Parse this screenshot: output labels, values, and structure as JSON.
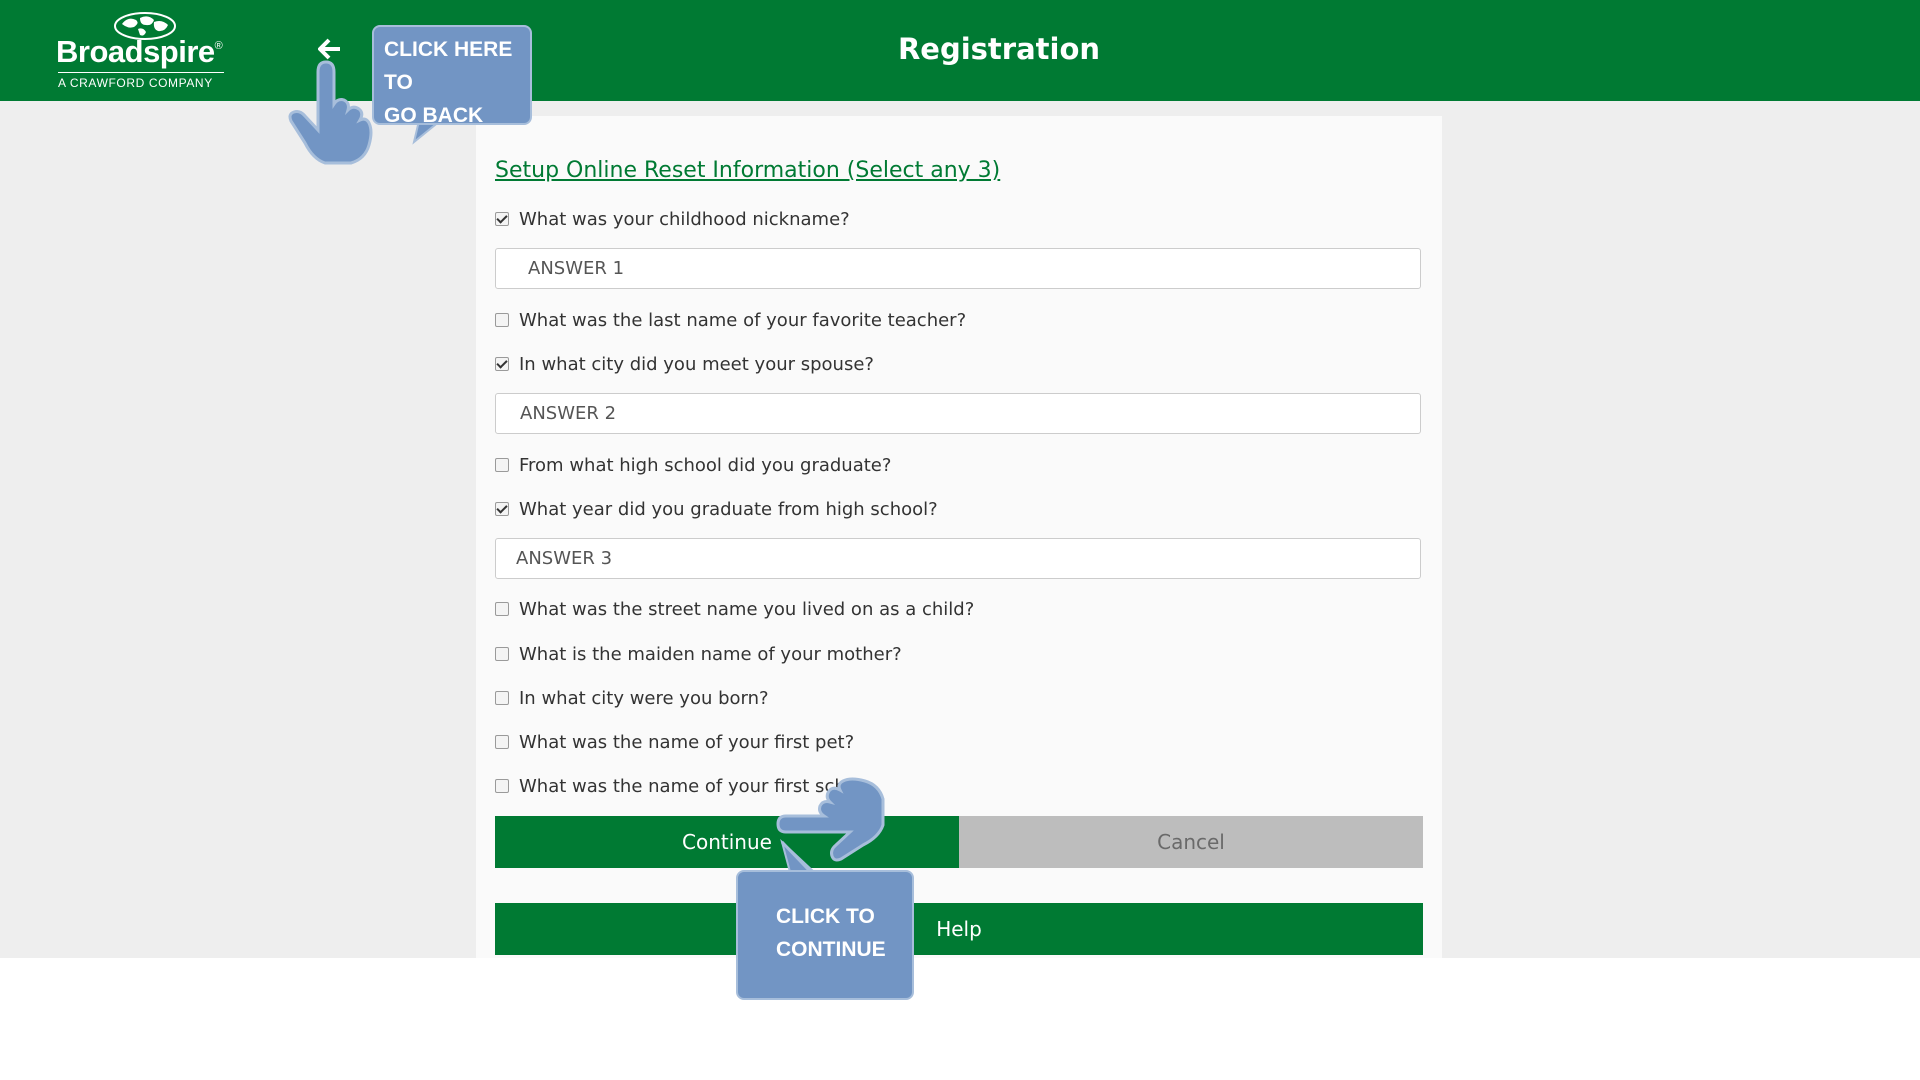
{
  "header": {
    "logo_name": "Broadspire",
    "logo_reg": "®",
    "logo_sub": "A CRAWFORD COMPANY",
    "back_icon": "arrow-left-icon",
    "title": "Registration",
    "color": "#007a33"
  },
  "form": {
    "section_title": "Setup Online Reset Information (Select any 3)",
    "questions": [
      {
        "label": "What was your childhood nickname?",
        "checked": true
      },
      {
        "label": "What was the last name of your favorite teacher?",
        "checked": false
      },
      {
        "label": "In what city did you meet your spouse?",
        "checked": true
      },
      {
        "label": "From what high school did you graduate?",
        "checked": false
      },
      {
        "label": "What year did you graduate from high school?",
        "checked": true
      },
      {
        "label": "What was the street name you lived on as a child?",
        "checked": false
      },
      {
        "label": "What is the maiden name of your mother?",
        "checked": false
      },
      {
        "label": "In what city were you born?",
        "checked": false
      },
      {
        "label": "What was the name of your first pet?",
        "checked": false
      },
      {
        "label": "What was the name of your first sch",
        "checked": false
      }
    ],
    "answers": [
      {
        "value": "ANSWER 1",
        "placeholder": ""
      },
      {
        "value": "ANSWER 2",
        "placeholder": ""
      },
      {
        "value": "ANSWER 3",
        "placeholder": ""
      }
    ],
    "buttons": {
      "continue": "Continue",
      "cancel": "Cancel",
      "help": "Help"
    }
  },
  "callouts": {
    "back": {
      "line1": "CLICK HERE TO",
      "line2": "GO BACK"
    },
    "continue": {
      "line1": "CLICK TO",
      "line2": "CONTINUE"
    },
    "color": "#7295c4"
  }
}
